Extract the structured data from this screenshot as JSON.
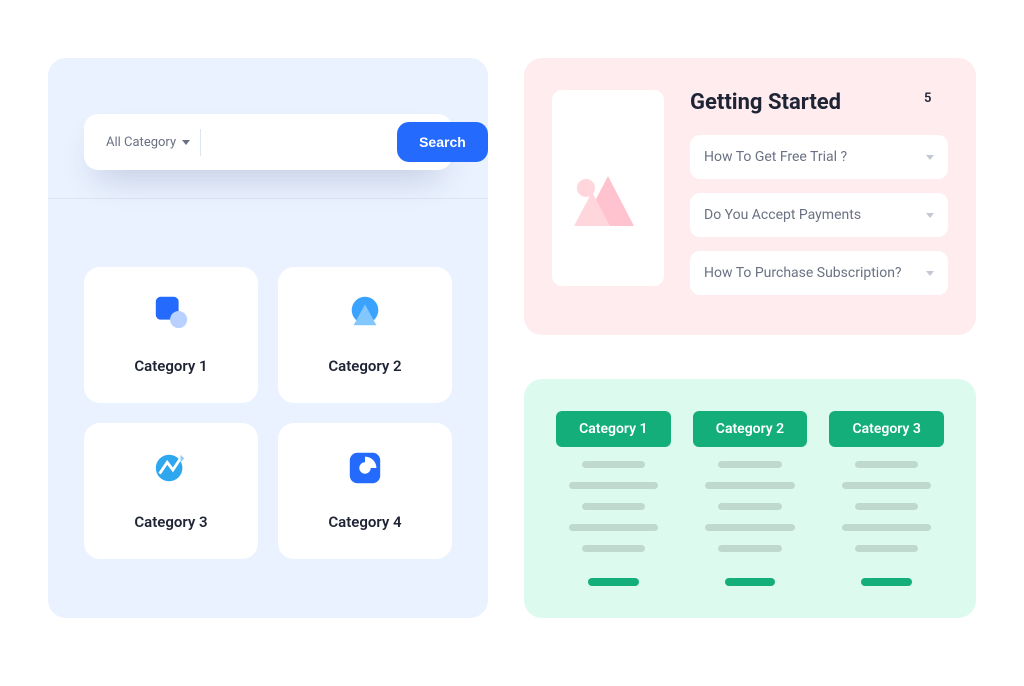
{
  "search": {
    "dropdown_label": "All Category",
    "button_label": "Search",
    "placeholder": ""
  },
  "categories": [
    {
      "icon": "square-circle",
      "label": "Category 1"
    },
    {
      "icon": "triangle-circle",
      "label": "Category 2"
    },
    {
      "icon": "refresh-line",
      "label": "Category 3"
    },
    {
      "icon": "pie-square",
      "label": "Category 4"
    }
  ],
  "faq": {
    "title": "Getting Started",
    "count": "5",
    "items": [
      "How To Get Free Trial ?",
      "Do You Accept Payments",
      "How To Purchase Subscription?"
    ]
  },
  "plans": {
    "columns": [
      {
        "label": "Category 1"
      },
      {
        "label": "Category 2"
      },
      {
        "label": "Category 3"
      }
    ]
  }
}
